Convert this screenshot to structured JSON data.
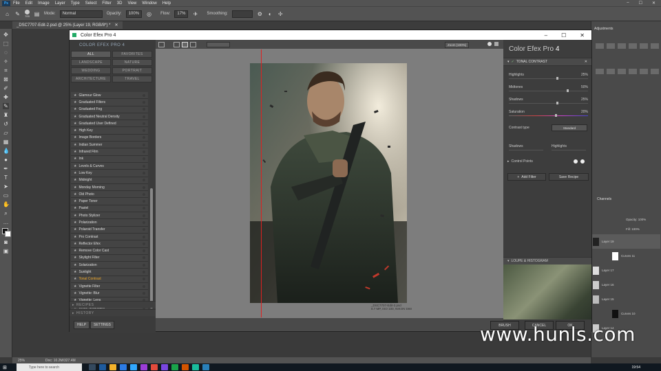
{
  "menu": [
    "File",
    "Edit",
    "Image",
    "Layer",
    "Type",
    "Select",
    "Filter",
    "3D",
    "View",
    "Window",
    "Help"
  ],
  "options": {
    "brush_size": "700",
    "mode_label": "Mode:",
    "mode_value": "Normal",
    "opacity_label": "Opacity:",
    "opacity_value": "100%",
    "flow_label": "Flow:",
    "flow_value": "17%",
    "smoothing_label": "Smoothing:"
  },
  "doc_tab": "_DSC7707-Edit-2.psd @ 25% (Layer 19, RGB/8*) *",
  "status": {
    "zoom": "25%",
    "doc": "Doc: 10.2M/327.4M"
  },
  "taskbar": {
    "search_placeholder": "Type here to search",
    "time": "19:54"
  },
  "dialog": {
    "title": "Color Efex Pro 4",
    "left_header": "COLOR EFEX PRO 4",
    "categories": [
      "ALL",
      "FAVORITES",
      "LANDSCAPE",
      "NATURE",
      "WEDDING",
      "PORTRAIT",
      "ARCHITECTURE",
      "TRAVEL"
    ],
    "filters": [
      "Glamour Glow",
      "Graduated Filters",
      "Graduated Fog",
      "Graduated Neutral Density",
      "Graduated User Defined",
      "High Key",
      "Image Borders",
      "Indian Summer",
      "Infrared Film",
      "Ink",
      "Levels & Curves",
      "Low Key",
      "Midnight",
      "Monday Morning",
      "Old Photo",
      "Paper Toner",
      "Pastel",
      "Photo Stylizer",
      "Polarization",
      "Polaroid Transfer",
      "Pro Contrast",
      "Reflector Efex",
      "Remove Color Cast",
      "Skylight Filter",
      "Solarization",
      "Sunlight",
      "Tonal Contrast",
      "Vignette Filter",
      "Vignette: Blur",
      "Vignette: Lens",
      "White Neutralizer"
    ],
    "selected_filter": "Tonal Contrast",
    "sections": {
      "recipes": "RECIPES",
      "history": "HISTORY"
    },
    "help_btn": "HELP",
    "settings_btn": "SETTINGS",
    "zoom_label": "Zoom (100%)",
    "file_name": "_DSC7707-Edit-2.psd",
    "file_info": "8.7 MP, ISO 100, NIKON D80",
    "right_title": "Color Efex Pro",
    "right_title_num": "4",
    "filter_section": "TONAL CONTRAST",
    "sliders": [
      {
        "label": "Highlights",
        "value": "25%",
        "level": 0.62
      },
      {
        "label": "Midtones",
        "value": "50%",
        "level": 0.75
      },
      {
        "label": "Shadows",
        "value": "25%",
        "level": 0.62
      },
      {
        "label": "Saturation",
        "value": "20%",
        "level": 0.6
      }
    ],
    "contrast_type_label": "Contrast type",
    "contrast_type_value": "Standard",
    "shadows_label": "Shadows",
    "highlights_label": "Highlights",
    "control_points": "Control Points",
    "add_filter": "Add Filter",
    "save_recipe": "Save Recipe",
    "loupe": "LOUPE & HISTOGRAM",
    "brush_btn": "BRUSH",
    "cancel_btn": "CANCEL",
    "ok_btn": "OK"
  },
  "layers": {
    "panel_tab": "Adjustments",
    "channels_tab": "Channels",
    "opacity": "100%",
    "fill": "100%",
    "items": [
      "Layer 19",
      "Curves 11",
      "Layer 17",
      "Layer 16",
      "Layer 15",
      "Curves 10",
      "Layer 14"
    ]
  },
  "watermark": "www.hunls.com"
}
